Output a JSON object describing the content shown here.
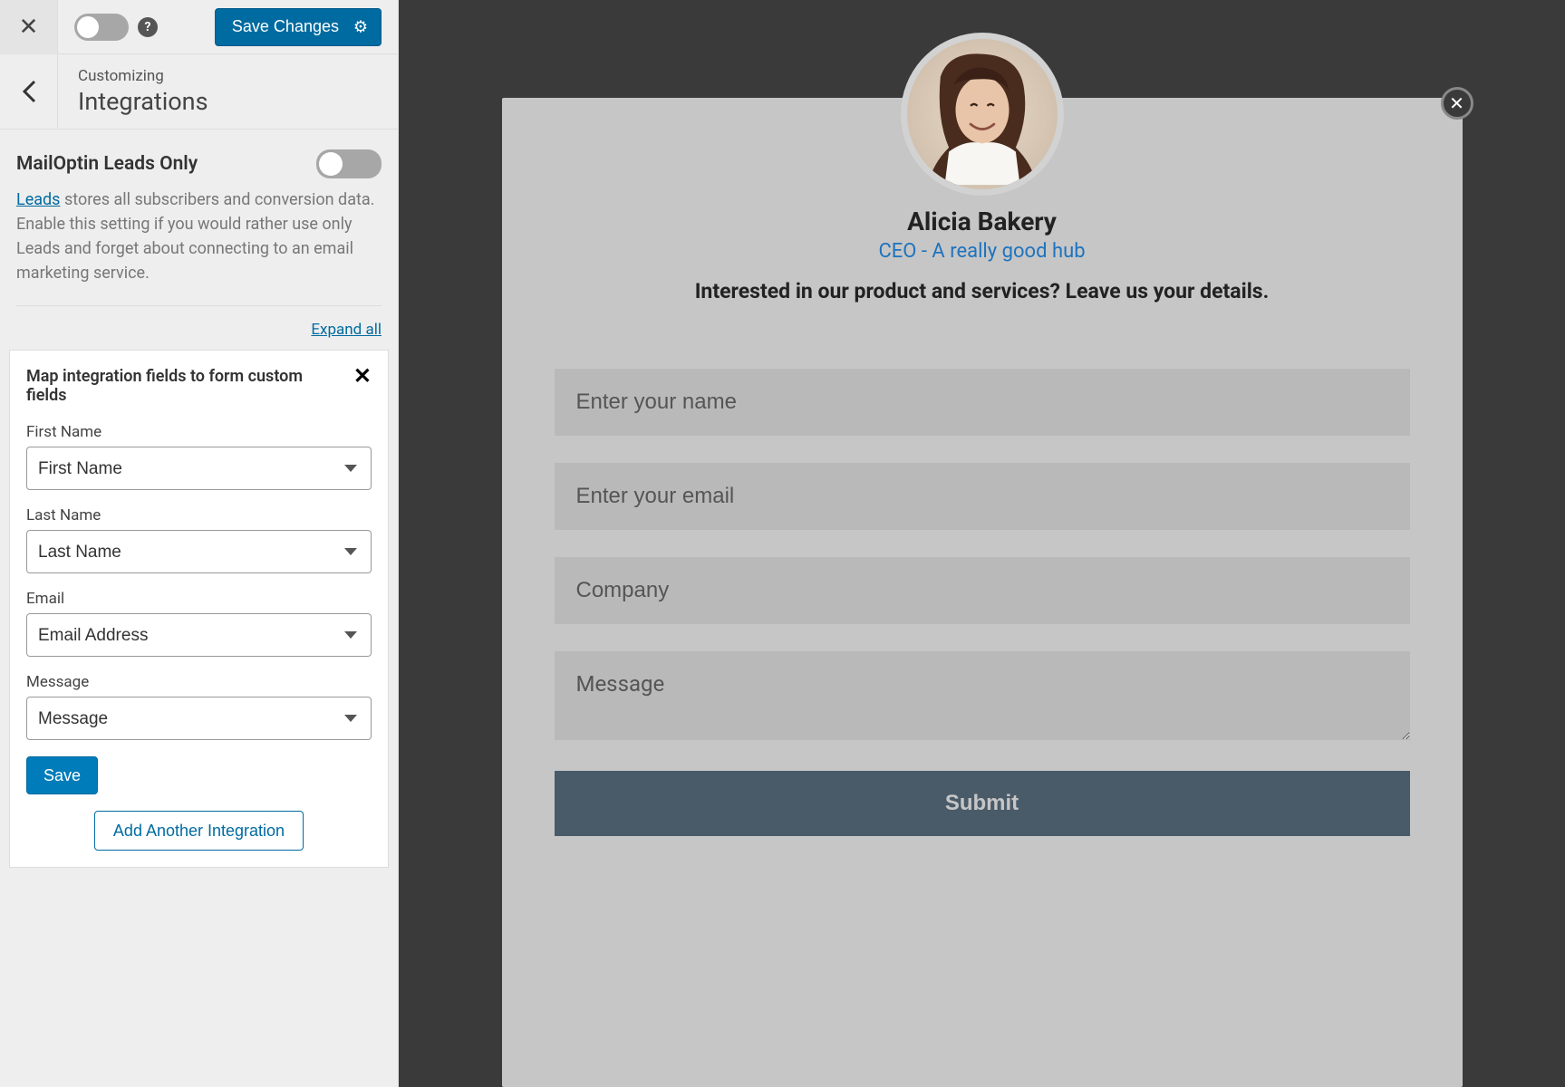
{
  "topbar": {
    "save_changes_label": "Save Changes"
  },
  "crumb": {
    "customizing_label": "Customizing",
    "section_title": "Integrations"
  },
  "leads": {
    "title": "MailOptin Leads Only",
    "link_text": "Leads",
    "description_rest": " stores all subscribers and conversion data. Enable this setting if you would rather use only Leads and forget about connecting to an email marketing service.",
    "expand_all": "Expand all"
  },
  "panel": {
    "title": "Map integration fields to form custom fields",
    "fields": [
      {
        "label": "First Name",
        "value": "First Name"
      },
      {
        "label": "Last Name",
        "value": "Last Name"
      },
      {
        "label": "Email",
        "value": "Email Address"
      },
      {
        "label": "Message",
        "value": "Message"
      }
    ],
    "save_label": "Save",
    "add_another_label": "Add Another Integration"
  },
  "preview": {
    "name": "Alicia Bakery",
    "subtitle": "CEO - A really good hub",
    "prompt": "Interested in our product and services? Leave us your details.",
    "placeholders": {
      "name": "Enter your name",
      "email": "Enter your email",
      "company": "Company",
      "message": "Message"
    },
    "submit_label": "Submit"
  }
}
